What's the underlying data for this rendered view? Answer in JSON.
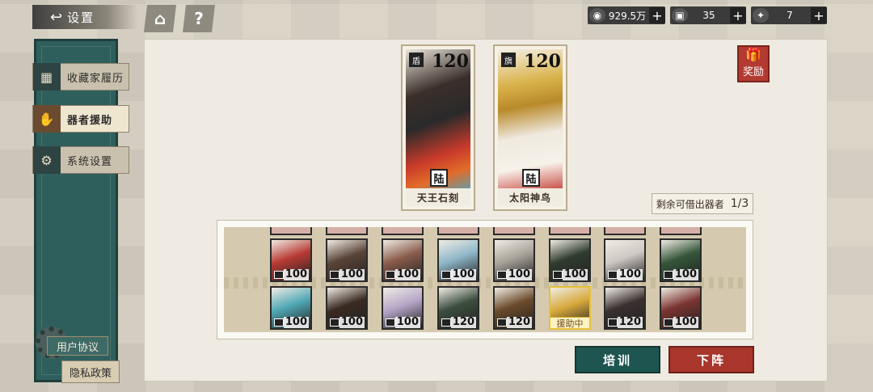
{
  "header": {
    "title": "设置",
    "home_icon": "home-icon",
    "help_label": "?"
  },
  "resources": [
    {
      "icon": "coin-icon",
      "value": "929.5万"
    },
    {
      "icon": "ticket-icon",
      "value": "35"
    },
    {
      "icon": "gem-icon",
      "value": "7"
    }
  ],
  "sidebar": {
    "items": [
      {
        "label": "收藏家履历",
        "icon": "portrait-icon",
        "active": false
      },
      {
        "label": "器者援助",
        "icon": "handshake-icon",
        "active": true
      },
      {
        "label": "系统设置",
        "icon": "gear-icon",
        "active": false
      }
    ],
    "user_agreement": "用户协议",
    "privacy_policy": "隐私政策"
  },
  "selected_cards": [
    {
      "name": "天王石刻",
      "level": "120",
      "seal": "陆",
      "accent": "#c83a2a"
    },
    {
      "name": "太阳神鸟",
      "level": "120",
      "seal": "陆",
      "accent": "#d9b24a"
    }
  ],
  "reward_label": "奖励",
  "remaining": {
    "label": "剩余可借出器者",
    "value": "1/3"
  },
  "grid": {
    "row1": [
      {
        "level": "100",
        "color": "#b83a34"
      },
      {
        "level": "100",
        "color": "#5a4438"
      },
      {
        "level": "100",
        "color": "#8a5c4c"
      },
      {
        "level": "100",
        "color": "#8fb7c8"
      },
      {
        "level": "100",
        "color": "#a9a39a"
      },
      {
        "level": "100",
        "color": "#2f3c2e"
      },
      {
        "level": "100",
        "color": "#cfc8c4"
      },
      {
        "level": "100",
        "color": "#34563a"
      }
    ],
    "row2": [
      {
        "level": "100",
        "color": "#4fa8b5"
      },
      {
        "level": "100",
        "color": "#3a2a22"
      },
      {
        "level": "100",
        "color": "#b6a7c8"
      },
      {
        "level": "120",
        "color": "#3c4e3f"
      },
      {
        "level": "120",
        "color": "#6a4a2a"
      },
      {
        "level": "",
        "color": "#d8a93c",
        "helping": "援助中"
      },
      {
        "level": "120",
        "color": "#3a3030"
      },
      {
        "level": "100",
        "color": "#7a3430"
      }
    ]
  },
  "buttons": {
    "train": "培训",
    "remove": "下阵"
  }
}
